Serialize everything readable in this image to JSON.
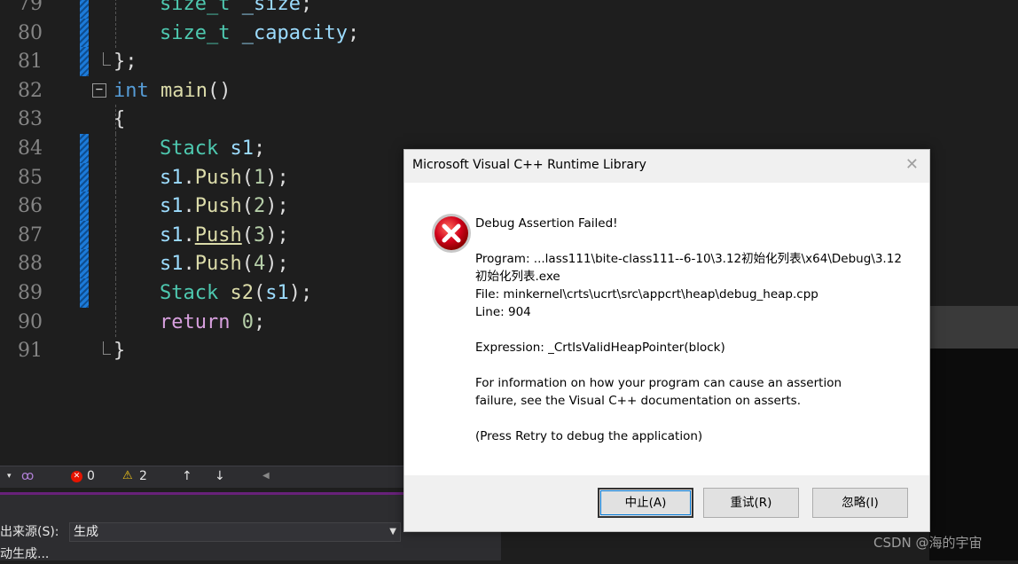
{
  "editor": {
    "lines": [
      {
        "num": "79",
        "tokens": [
          {
            "c": "t",
            "s": "size_t"
          },
          {
            "c": "p",
            "s": " "
          },
          {
            "c": "v",
            "s": "_size"
          },
          {
            "c": "p",
            "s": ";"
          }
        ]
      },
      {
        "num": "80",
        "tokens": [
          {
            "c": "t",
            "s": "size_t"
          },
          {
            "c": "p",
            "s": " "
          },
          {
            "c": "v",
            "s": "_capacity"
          },
          {
            "c": "p",
            "s": ";"
          }
        ]
      },
      {
        "num": "81",
        "tokens": [
          {
            "c": "p",
            "s": "};"
          }
        ]
      },
      {
        "num": "82",
        "tokens": [
          {
            "c": "k",
            "s": "int"
          },
          {
            "c": "p",
            "s": " "
          },
          {
            "c": "f",
            "s": "main"
          },
          {
            "c": "p",
            "s": "()"
          }
        ]
      },
      {
        "num": "83",
        "tokens": [
          {
            "c": "p",
            "s": "{"
          }
        ]
      },
      {
        "num": "84",
        "tokens": [
          {
            "c": "t",
            "s": "Stack"
          },
          {
            "c": "p",
            "s": " "
          },
          {
            "c": "v",
            "s": "s1"
          },
          {
            "c": "p",
            "s": ";"
          }
        ]
      },
      {
        "num": "85",
        "tokens": [
          {
            "c": "v",
            "s": "s1"
          },
          {
            "c": "p",
            "s": "."
          },
          {
            "c": "f",
            "s": "Push"
          },
          {
            "c": "p",
            "s": "("
          },
          {
            "c": "n",
            "s": "1"
          },
          {
            "c": "p",
            "s": ");"
          }
        ]
      },
      {
        "num": "86",
        "tokens": [
          {
            "c": "v",
            "s": "s1"
          },
          {
            "c": "p",
            "s": "."
          },
          {
            "c": "f",
            "s": "Push"
          },
          {
            "c": "p",
            "s": "("
          },
          {
            "c": "n",
            "s": "2"
          },
          {
            "c": "p",
            "s": ");"
          }
        ]
      },
      {
        "num": "87",
        "tokens": [
          {
            "c": "v",
            "s": "s1"
          },
          {
            "c": "p",
            "s": "."
          },
          {
            "c": "f u",
            "s": "Push"
          },
          {
            "c": "p",
            "s": "("
          },
          {
            "c": "n",
            "s": "3"
          },
          {
            "c": "p",
            "s": ");"
          }
        ]
      },
      {
        "num": "88",
        "tokens": [
          {
            "c": "v",
            "s": "s1"
          },
          {
            "c": "p",
            "s": "."
          },
          {
            "c": "f",
            "s": "Push"
          },
          {
            "c": "p",
            "s": "("
          },
          {
            "c": "n",
            "s": "4"
          },
          {
            "c": "p",
            "s": ");"
          }
        ]
      },
      {
        "num": "89",
        "tokens": [
          {
            "c": "t",
            "s": "Stack"
          },
          {
            "c": "p",
            "s": " "
          },
          {
            "c": "f",
            "s": "s2"
          },
          {
            "c": "p",
            "s": "("
          },
          {
            "c": "v",
            "s": "s1"
          },
          {
            "c": "p",
            "s": ");"
          }
        ]
      },
      {
        "num": "90",
        "tokens": [
          {
            "c": "kw",
            "s": "return"
          },
          {
            "c": "p",
            "s": " "
          },
          {
            "c": "n",
            "s": "0"
          },
          {
            "c": "p",
            "s": ";"
          }
        ]
      },
      {
        "num": "91",
        "tokens": [
          {
            "c": "p",
            "s": "}"
          }
        ]
      }
    ],
    "fold_symbol": "−"
  },
  "status": {
    "errors": "0",
    "warnings": "2"
  },
  "output": {
    "source_label": "出来源(S):",
    "source_value": "生成",
    "log_line": "动生成..."
  },
  "dialog": {
    "title": "Microsoft Visual C++ Runtime Library",
    "close": "✕",
    "heading": "Debug Assertion Failed!",
    "program_line1": "Program: ...lass111\\bite-class111--6-10\\3.12初始化列表\\x64\\Debug\\3.12",
    "program_line2": "初始化列表.exe",
    "file_line": "File: minkernel\\crts\\ucrt\\src\\appcrt\\heap\\debug_heap.cpp",
    "line_line": "Line: 904",
    "expression_line": "Expression: _CrtIsValidHeapPointer(block)",
    "info_line1": "For information on how your program can cause an assertion",
    "info_line2": "failure, see the Visual C++ documentation on asserts.",
    "retry_hint": "(Press Retry to debug the application)",
    "buttons": {
      "abort": "中止(A)",
      "retry": "重试(R)",
      "ignore": "忽略(I)"
    }
  },
  "watermark": "CSDN @海的宇宙",
  "colors": {
    "editor_bg": "#1e1e1e",
    "accent_purple": "#68217a",
    "error_red": "#d0021b"
  }
}
